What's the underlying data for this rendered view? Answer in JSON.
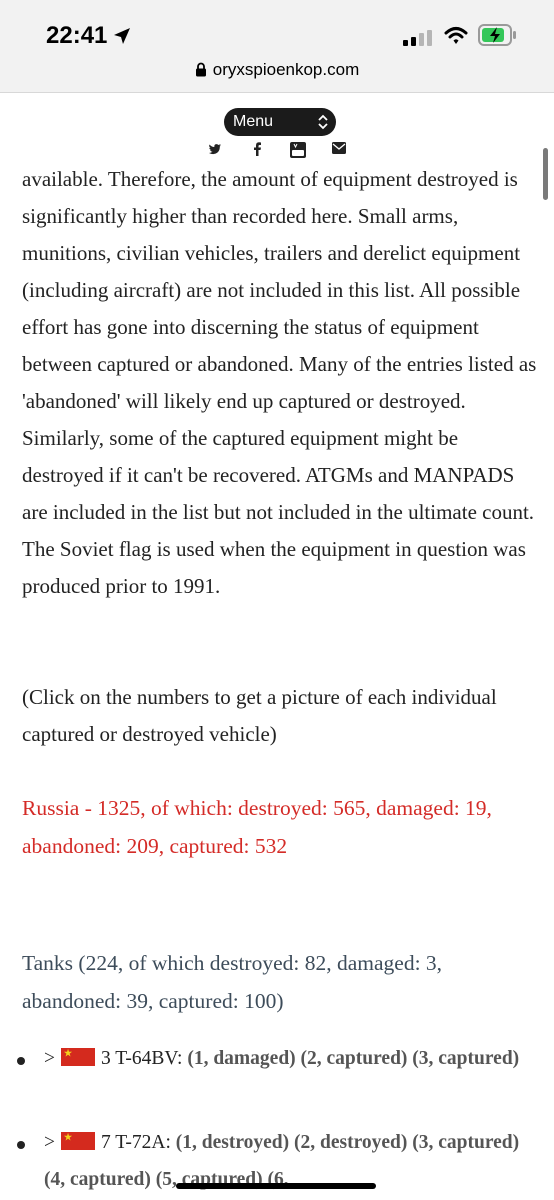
{
  "status_bar": {
    "time": "22:41",
    "icons": [
      "location-arrow-icon",
      "cellular-signal-icon",
      "wifi-icon",
      "battery-charging-icon"
    ],
    "battery_color": "#34c759"
  },
  "browser": {
    "url": "oryxspioenkop.com",
    "lock_icon": "lock-icon"
  },
  "site_nav": {
    "menu_label": "Menu",
    "social_icons": [
      "twitter-icon",
      "facebook-icon",
      "youtube-icon",
      "email-icon"
    ]
  },
  "article": {
    "intro_paragraph": "available. Therefore, the amount of equipment destroyed is significantly higher than recorded here. Small arms, munitions, civilian vehicles, trailers and derelict equipment (including aircraft) are not included in this list. All possible effort has gone into discerning the status of equipment between captured or abandoned. Many of the entries listed as 'abandoned' will likely end up captured or destroyed. Similarly, some of the captured equipment might be destroyed if it can't be recovered. ATGMs and MANPADS are included in the list but not included in the ultimate count. The Soviet flag is used when the equipment in question was produced prior to 1991.",
    "click_note": "(Click on the numbers to get a picture of each individual captured or destroyed vehicle)",
    "russia_summary": "Russia - 1325, of which: destroyed: 565, damaged: 19, abandoned: 209, captured: 532",
    "russia_color": "#d42b27",
    "tanks_heading": "Tanks (224, of which destroyed: 82, damaged: 3, abandoned: 39, captured: 100)",
    "tanks_color": "#3d4c5a",
    "entries": [
      {
        "caret": ">",
        "flag": "soviet-flag-icon",
        "name": "3 T-64BV:",
        "links": "(1, damaged) (2, captured) (3, captured)"
      },
      {
        "caret": ">",
        "flag": "soviet-flag-icon",
        "name": "7 T-72A:",
        "links": "(1, destroyed) (2, destroyed) (3, captured) (4, captured) (5, captured) (6,"
      }
    ]
  }
}
